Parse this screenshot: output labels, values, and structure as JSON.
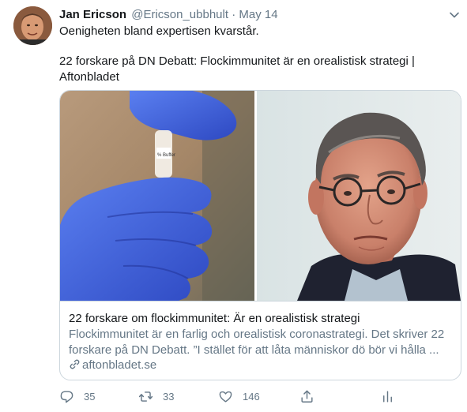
{
  "tweet": {
    "author_name": "Jan Ericson",
    "handle": "@Ericson_ubbhult",
    "separator": "·",
    "date": "May 14",
    "text_line1": "Oenigheten bland expertisen kvarstår.",
    "text_line2": "22 forskare på DN Debatt: Flockimmunitet är en orealistisk strategi |",
    "text_line3": "Aftonbladet"
  },
  "card": {
    "image_left": "gloved-hand-holding-test-tube",
    "image_left_tube_label": "% Buffer",
    "image_right": "man-with-glasses-portrait",
    "title": "22 forskare om flockimmunitet: Är en orealistisk strategi",
    "description_line1": "Flockimmunitet är en farlig och orealistisk coronastrategi. Det skriver 22",
    "description_line2": "forskare på DN Debatt. ”I stället för att låta människor dö bör vi hålla ...",
    "link_domain": "aftonbladet.se",
    "link_icon": "link-icon"
  },
  "actions": {
    "reply_count": "35",
    "retweet_count": "33",
    "like_count": "146",
    "reply_icon": "reply-icon",
    "retweet_icon": "retweet-icon",
    "like_icon": "heart-icon",
    "share_icon": "share-icon",
    "stats_icon": "analytics-icon"
  },
  "colors": {
    "text": "#14171a",
    "secondary": "#657786",
    "border": "#ccd6dd",
    "glove_blue": "#3f5fd6"
  }
}
